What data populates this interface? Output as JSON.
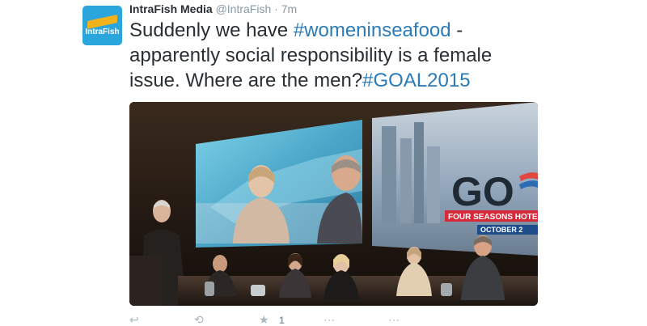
{
  "tweet": {
    "avatar_text": "IntraFish",
    "display_name": "IntraFish Media",
    "handle": "@IntraFish",
    "separator": "·",
    "time": "7m",
    "text_part1": "Suddenly we have ",
    "hashtag1": "#womeninseafood",
    "text_part2": " - apparently social responsibility is a female issue. Where are the men?",
    "hashtag2": "#GOAL2015"
  },
  "media": {
    "slide_logo_text": "GO",
    "slide_line1": "FOUR SEASONS HOTEL",
    "slide_line2": "OCTOBER 2"
  },
  "actions": {
    "favorite_count": "1"
  },
  "colors": {
    "link": "#2b7bb9",
    "text": "#292f33",
    "muted": "#8899a6",
    "brand": "#2aa6dc"
  }
}
